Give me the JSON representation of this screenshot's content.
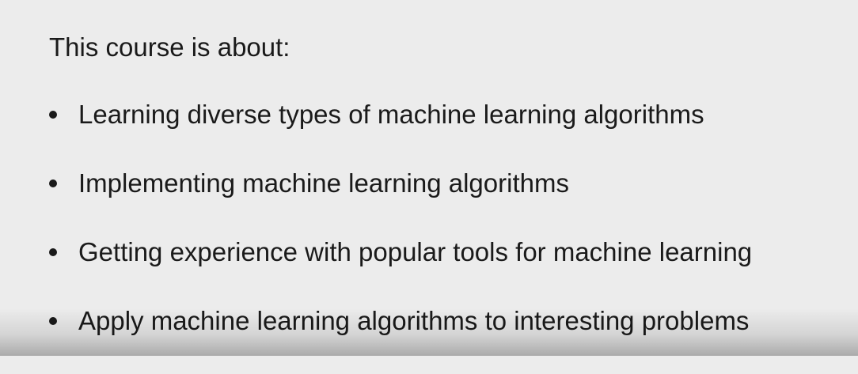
{
  "slide": {
    "intro": "This course is about:",
    "bullets": [
      "Learning diverse types of machine learning algorithms",
      "Implementing machine learning algorithms",
      "Getting experience with popular tools for machine learning",
      "Apply machine learning algorithms to interesting problems"
    ]
  }
}
